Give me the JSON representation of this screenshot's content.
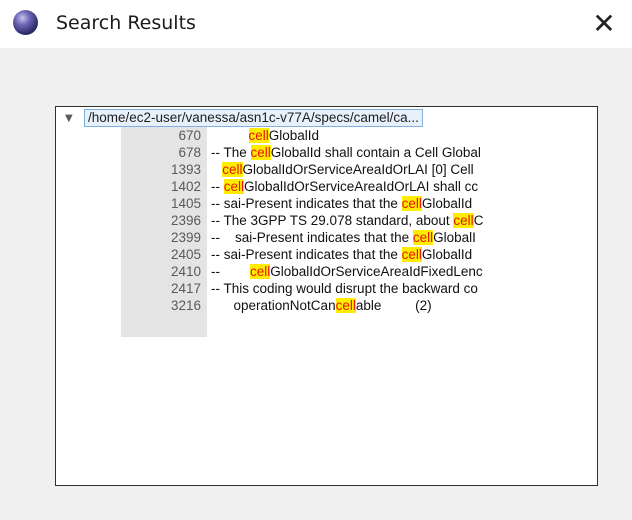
{
  "window": {
    "title": "Search Results",
    "app_icon": "eclipse-icon",
    "close_icon": "close-icon",
    "close_glyph": "✕"
  },
  "tree": {
    "expander": "▼",
    "path": "/home/ec2-user/vanessa/asn1c-v77A/specs/camel/ca...",
    "results": [
      {
        "line": "670",
        "pre": "          ",
        "match": "cell",
        "post": "GlobalId"
      },
      {
        "line": "678",
        "pre": "-- The ",
        "match": "cell",
        "post": "GlobalId shall contain a Cell Global"
      },
      {
        "line": "1393",
        "pre": "   ",
        "match": "cell",
        "post": "GlobalIdOrServiceAreaIdOrLAI [0] Cell"
      },
      {
        "line": "1402",
        "pre": "-- ",
        "match": "cell",
        "post": "GlobalIdOrServiceAreaIdOrLAI shall cc"
      },
      {
        "line": "1405",
        "pre": "-- sai-Present indicates that the ",
        "match": "cell",
        "post": "GlobalId"
      },
      {
        "line": "2396",
        "pre": "-- The 3GPP TS 29.078 standard, about ",
        "match": "cell",
        "post": "C"
      },
      {
        "line": "2399",
        "pre": "--    sai-Present indicates that the ",
        "match": "cell",
        "post": "GlobalI"
      },
      {
        "line": "2405",
        "pre": "-- sai-Present indicates that the ",
        "match": "cell",
        "post": "GlobalId"
      },
      {
        "line": "2410",
        "pre": "--        ",
        "match": "cell",
        "post": "GlobalIdOrServiceAreaIdFixedLenc"
      },
      {
        "line": "2417",
        "pre": "-- This coding would disrupt the backward co",
        "match": "",
        "post": ""
      },
      {
        "line": "3216",
        "pre": "      operationNotCan",
        "match": "cell",
        "post": "able         (2)"
      }
    ]
  },
  "colors": {
    "highlight_bg": "#ffec00",
    "highlight_fg": "#e81400",
    "gutter": "#e4e4e4"
  }
}
